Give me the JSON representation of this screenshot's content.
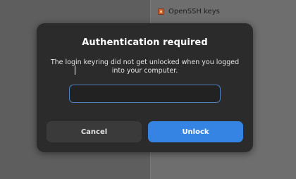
{
  "background": {
    "list_item": {
      "icon": "keyring-icon",
      "label": "OpenSSH keys"
    }
  },
  "dialog": {
    "title": "Authentication required",
    "message": "The login keyring did not get unlocked when you logged into your computer.",
    "password_field": {
      "value": "",
      "placeholder": ""
    },
    "buttons": {
      "cancel_label": "Cancel",
      "unlock_label": "Unlock"
    }
  },
  "colors": {
    "accent": "#3584e4",
    "dialog_background": "#2b2b2b",
    "field_border": "#4e7fbf",
    "cancel_button": "#3a3a3a"
  }
}
